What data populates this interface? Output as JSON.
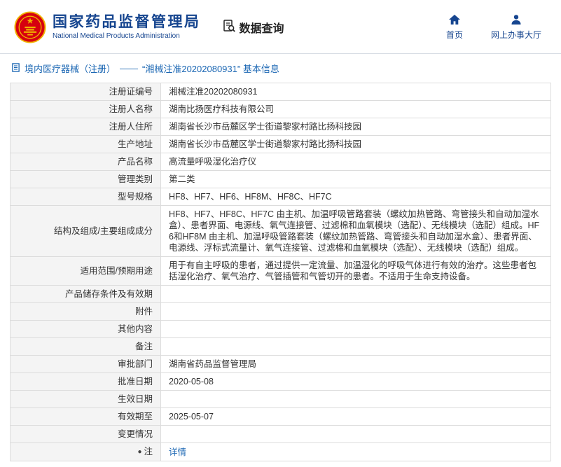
{
  "header": {
    "agency_cn": "国家药品监督管理局",
    "agency_en": "National Medical Products Administration",
    "section_title": "数据查询",
    "nav_home": "首页",
    "nav_hall": "网上办事大厅"
  },
  "breadcrumb": {
    "category": "境内医疗器械（注册）",
    "dash": "——",
    "title": "“湘械注准20202080931” 基本信息"
  },
  "table": {
    "rows": [
      {
        "label": "注册证编号",
        "value": "湘械注准20202080931"
      },
      {
        "label": "注册人名称",
        "value": "湖南比扬医疗科技有限公司"
      },
      {
        "label": "注册人住所",
        "value": "湖南省长沙市岳麓区学士街道黎家村路比扬科技园"
      },
      {
        "label": "生产地址",
        "value": "湖南省长沙市岳麓区学士街道黎家村路比扬科技园"
      },
      {
        "label": "产品名称",
        "value": "高流量呼吸湿化治疗仪"
      },
      {
        "label": "管理类别",
        "value": "第二类"
      },
      {
        "label": "型号规格",
        "value": "HF8、HF7、HF6、HF8M、HF8C、HF7C"
      },
      {
        "label": "结构及组成/主要组成成分",
        "value": "HF8、HF7、HF8C、HF7C 由主机、加温呼吸管路套装（螺纹加热管路、弯管接头和自动加湿水盒）、患者界面、电源线、氧气连接管、过滤棉和血氧模块（选配）、无线模块（选配）组成。HF6和HF8M 由主机、加温呼吸管路套装（螺纹加热管路、弯管接头和自动加湿水盒）、患者界面、电源线、浮标式流量计、氧气连接管、过滤棉和血氧模块（选配）、无线模块（选配）组成。"
      },
      {
        "label": "适用范围/预期用途",
        "value": "用于有自主呼吸的患者，通过提供一定流量、加温湿化的呼吸气体进行有效的治疗。这些患者包括湿化治疗、氧气治疗、气管插管和气管切开的患者。不适用于生命支持设备。"
      },
      {
        "label": "产品储存条件及有效期",
        "value": ""
      },
      {
        "label": "附件",
        "value": ""
      },
      {
        "label": "其他内容",
        "value": ""
      },
      {
        "label": "备注",
        "value": ""
      },
      {
        "label": "审批部门",
        "value": "湖南省药品监督管理局"
      },
      {
        "label": "批准日期",
        "value": "2020-05-08"
      },
      {
        "label": "生效日期",
        "value": ""
      },
      {
        "label": "有效期至",
        "value": "2025-05-07"
      },
      {
        "label": "变更情况",
        "value": ""
      },
      {
        "label": "注",
        "value": "详情"
      }
    ]
  },
  "colors": {
    "brand_blue": "#16458f",
    "link_blue": "#1a66b3",
    "label_bg": "#f4f4f4",
    "border": "#dcdcdc",
    "emblem_red": "#d6000f",
    "emblem_gold": "#f0b400"
  }
}
